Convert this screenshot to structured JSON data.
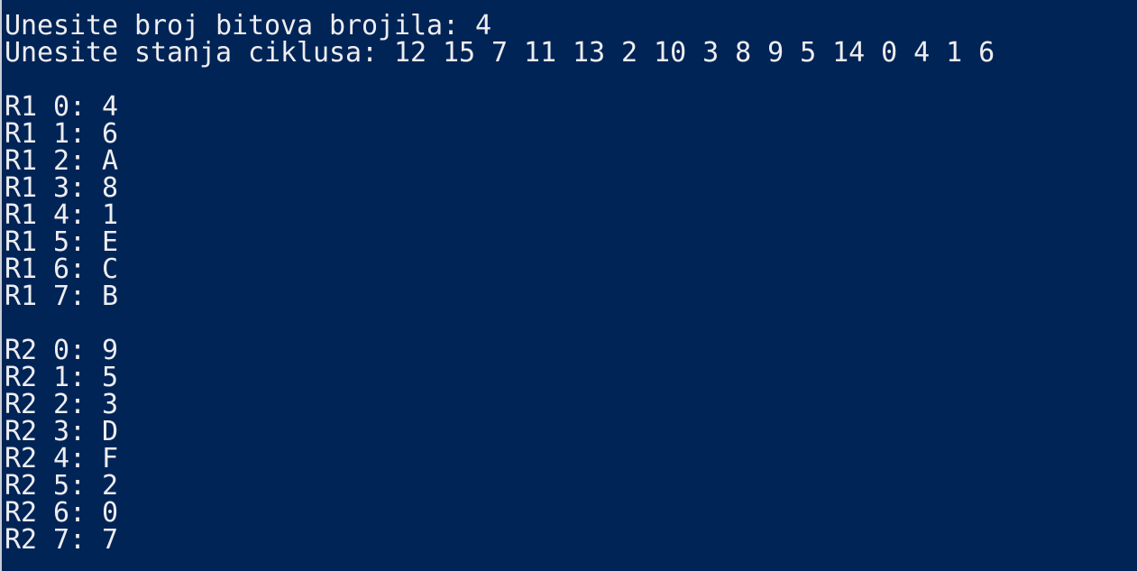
{
  "console": {
    "prompt_bits": "Unesite broj bitova brojila: 4",
    "prompt_states": "Unesite stanja ciklusa: 12 15 7 11 13 2 10 3 8 9 5 14 0 4 1 6",
    "r1": [
      "R1 0: 4",
      "R1 1: 6",
      "R1 2: A",
      "R1 3: 8",
      "R1 4: 1",
      "R1 5: E",
      "R1 6: C",
      "R1 7: B"
    ],
    "r2": [
      "R2 0: 9",
      "R2 1: 5",
      "R2 2: 3",
      "R2 3: D",
      "R2 4: F",
      "R2 5: 2",
      "R2 6: 0",
      "R2 7: 7"
    ]
  }
}
